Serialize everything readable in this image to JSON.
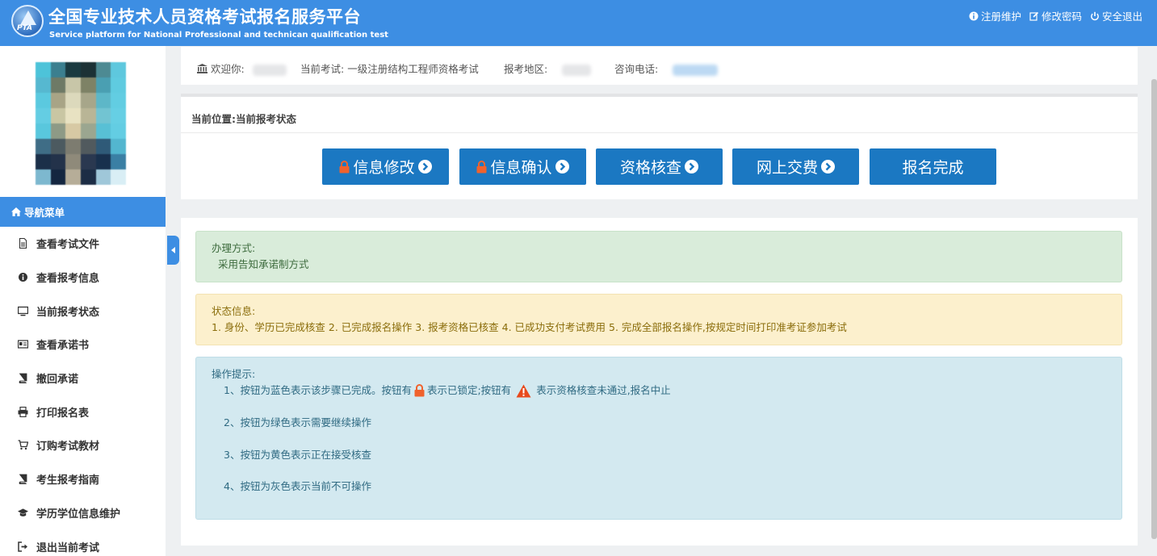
{
  "header": {
    "logo_text": "PTA",
    "title_cn": "全国专业技术人员资格考试报名服务平台",
    "title_en": "Service platform for National Professional and technican qualification test",
    "links": [
      {
        "label": "注册维护",
        "icon": "info-circle-icon"
      },
      {
        "label": "修改密码",
        "icon": "edit-icon"
      },
      {
        "label": "安全退出",
        "icon": "power-icon"
      }
    ]
  },
  "sidebar": {
    "nav_title": "导航菜单",
    "items": [
      {
        "label": "查看考试文件",
        "icon": "file-icon"
      },
      {
        "label": "查看报考信息",
        "icon": "info-circle-icon"
      },
      {
        "label": "当前报考状态",
        "icon": "monitor-icon"
      },
      {
        "label": "查看承诺书",
        "icon": "id-card-icon"
      },
      {
        "label": "撤回承诺",
        "icon": "book-icon"
      },
      {
        "label": "打印报名表",
        "icon": "print-icon"
      },
      {
        "label": "订购考试教材",
        "icon": "cart-icon"
      },
      {
        "label": "考生报考指南",
        "icon": "book-icon"
      },
      {
        "label": "学历学位信息维护",
        "icon": "graduation-cap-icon"
      },
      {
        "label": "退出当前考试",
        "icon": "sign-out-icon"
      }
    ]
  },
  "infobar": {
    "welcome_label": "欢迎你:",
    "exam_label": "当前考试:",
    "exam_value": "一级注册结构工程师资格考试",
    "region_label": "报考地区:",
    "phone_label": "咨询电话:"
  },
  "status": {
    "breadcrumb": "当前位置:当前报考状态",
    "steps": [
      {
        "label": "信息修改",
        "locked": true,
        "arrow": true
      },
      {
        "label": "信息确认",
        "locked": true,
        "arrow": true
      },
      {
        "label": "资格核查",
        "locked": false,
        "arrow": true
      },
      {
        "label": "网上交费",
        "locked": false,
        "arrow": true
      },
      {
        "label": "报名完成",
        "locked": false,
        "arrow": false
      }
    ]
  },
  "tips": {
    "method_title": "办理方式:",
    "method_value": "采用告知承诺制方式",
    "state_title": "状态信息:",
    "state_value": "1. 身份、学历已完成核查 2. 已完成报名操作 3. 报考资格已核查 4. 已成功支付考试费用 5. 完成全部报名操作,按规定时间打印准考证参加考试",
    "hint_title": "操作提示:",
    "hint1_a": "1、按钮为蓝色表示该步骤已完成。按钮有",
    "hint1_b": "表示已锁定;按钮有",
    "hint1_c": "表示资格核查未通过,报名中止",
    "hint2": "2、按钮为绿色表示需要继续操作",
    "hint3": "3、按钮为黄色表示正在接受核查",
    "hint4": "4、按钮为灰色表示当前不可操作"
  },
  "colors": {
    "header_bg": "#3d8ee3",
    "step_button": "#1b78c2",
    "lock_icon": "#f0622d",
    "warning_icon": "#e8491c"
  }
}
